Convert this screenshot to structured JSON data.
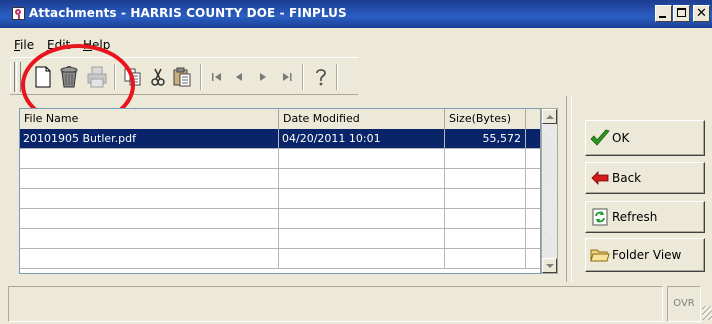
{
  "window": {
    "title": "Attachments - HARRIS COUNTY DOE - FINPLUS"
  },
  "menu": {
    "items": [
      {
        "label": "File",
        "underline": "F",
        "rest": "ile"
      },
      {
        "label": "Edit",
        "underline": "E",
        "rest": "dit"
      },
      {
        "label": "Help",
        "underline": "H",
        "rest": "elp"
      }
    ]
  },
  "toolbar": {
    "buttons": [
      {
        "name": "new-document",
        "icon": "blank-page-icon"
      },
      {
        "name": "delete",
        "icon": "trash-can-icon"
      },
      {
        "name": "print",
        "icon": "printer-icon"
      },
      {
        "name": "copy",
        "icon": "copy-icon"
      },
      {
        "name": "cut",
        "icon": "scissors-icon"
      },
      {
        "name": "paste",
        "icon": "clipboard-icon"
      },
      {
        "name": "first-record",
        "icon": "first-record-icon"
      },
      {
        "name": "previous-record",
        "icon": "previous-record-icon"
      },
      {
        "name": "next-record",
        "icon": "next-record-icon"
      },
      {
        "name": "last-record",
        "icon": "last-record-icon"
      },
      {
        "name": "help",
        "icon": "question-mark-icon"
      }
    ]
  },
  "grid": {
    "columns": [
      "File Name",
      "Date Modified",
      "Size(Bytes)"
    ],
    "rows": [
      {
        "file_name": "20101905 Butler.pdf",
        "date_modified": "04/20/2011  10:01",
        "size": "55,572",
        "selected": true
      },
      {
        "file_name": "",
        "date_modified": "",
        "size": ""
      },
      {
        "file_name": "",
        "date_modified": "",
        "size": ""
      },
      {
        "file_name": "",
        "date_modified": "",
        "size": ""
      },
      {
        "file_name": "",
        "date_modified": "",
        "size": ""
      },
      {
        "file_name": "",
        "date_modified": "",
        "size": ""
      },
      {
        "file_name": "",
        "date_modified": "",
        "size": ""
      }
    ]
  },
  "side_buttons": {
    "ok": {
      "label": "OK",
      "icon": "checkmark-icon"
    },
    "back": {
      "label": "Back",
      "icon": "back-arrow-icon"
    },
    "refresh": {
      "label": "Refresh",
      "icon": "refresh-icon"
    },
    "folder_view": {
      "label": "Folder View",
      "icon": "folder-icon"
    }
  },
  "status": {
    "main": "",
    "ovr": "OVR"
  },
  "colors": {
    "title_bar": "#2653b3",
    "selection": "#0a246a",
    "highlight_circle": "#e8141e",
    "window_face": "#ece9d8"
  }
}
